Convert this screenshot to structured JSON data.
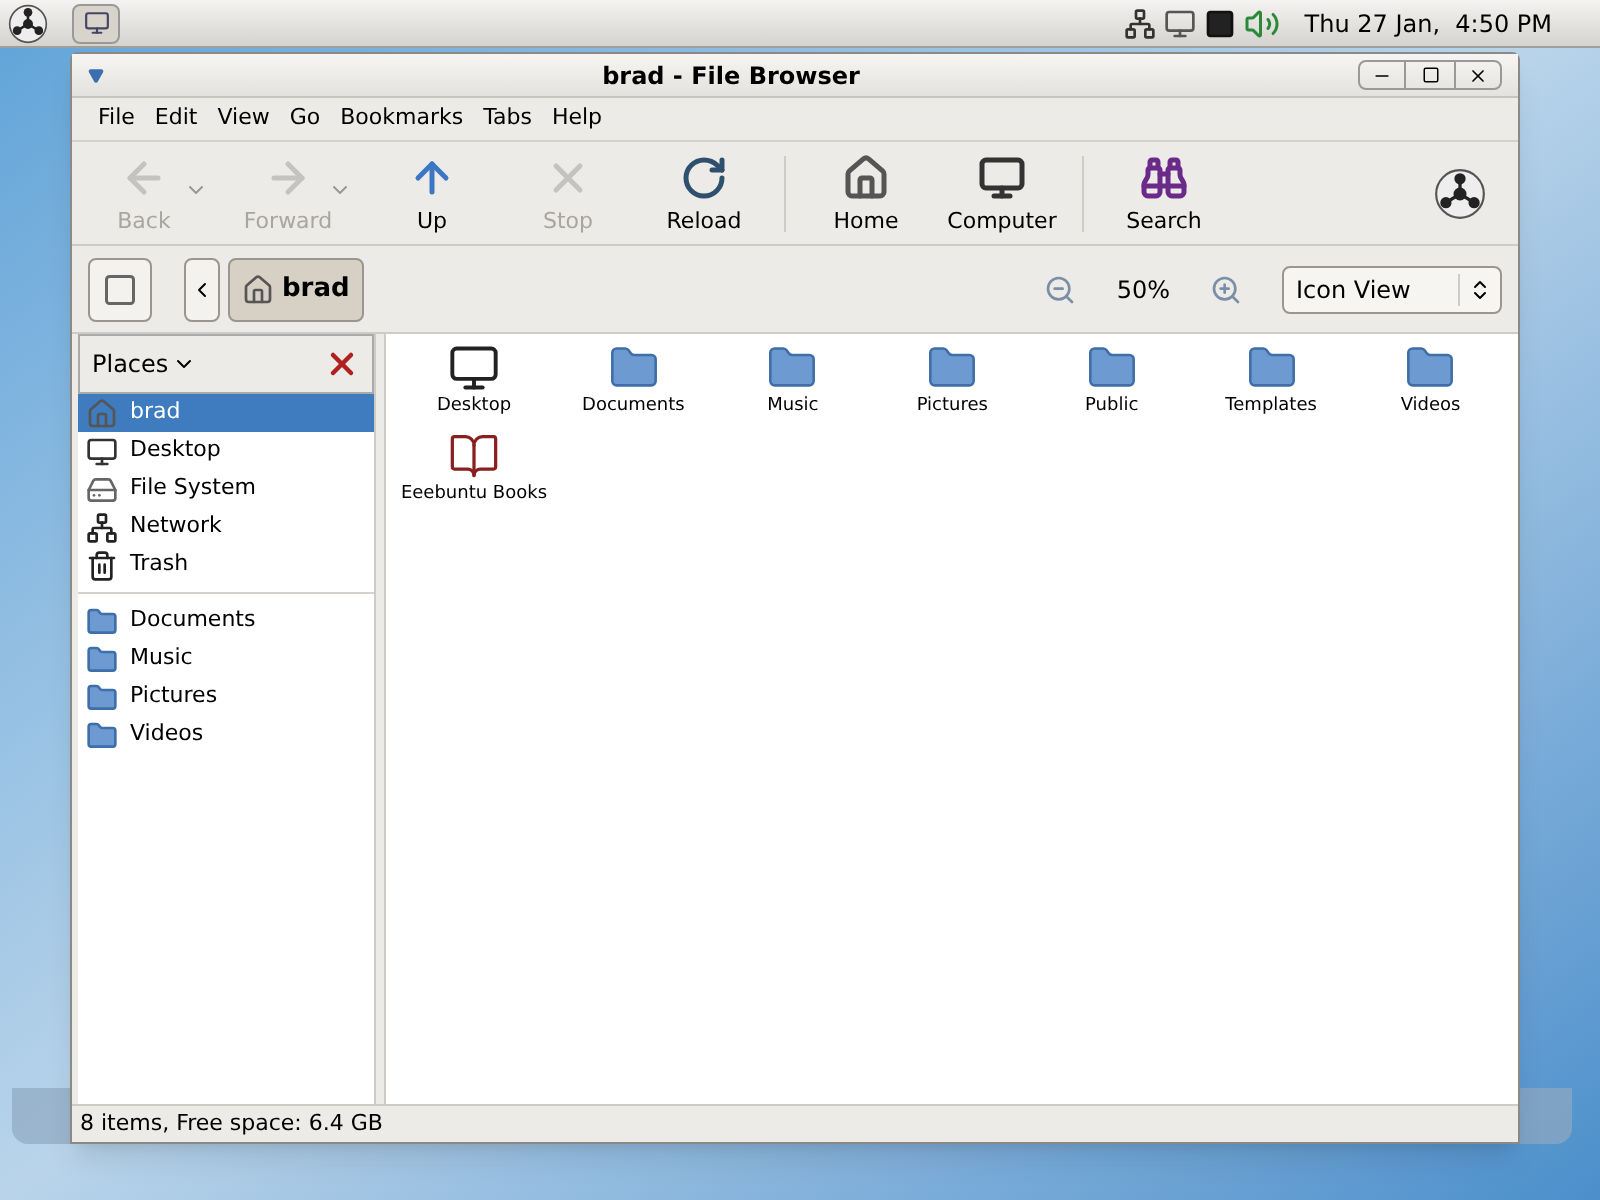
{
  "top_panel": {
    "clock": "Thu 27 Jan,  4:50 PM"
  },
  "window": {
    "title": "brad - File Browser"
  },
  "menu": [
    "File",
    "Edit",
    "View",
    "Go",
    "Bookmarks",
    "Tabs",
    "Help"
  ],
  "toolbar": [
    [
      {
        "kind": "back",
        "label": "Back",
        "disabled": true,
        "dropdown": true
      },
      {
        "kind": "forward",
        "label": "Forward",
        "disabled": true,
        "dropdown": true
      },
      {
        "kind": "up",
        "label": "Up",
        "disabled": false,
        "dropdown": false
      },
      {
        "kind": "stop",
        "label": "Stop",
        "disabled": true,
        "dropdown": false
      },
      {
        "kind": "reload",
        "label": "Reload",
        "disabled": false,
        "dropdown": false
      }
    ],
    [
      {
        "kind": "home",
        "label": "Home",
        "disabled": false,
        "dropdown": false
      },
      {
        "kind": "computer",
        "label": "Computer",
        "disabled": false,
        "dropdown": false
      }
    ],
    [
      {
        "kind": "search",
        "label": "Search",
        "disabled": false,
        "dropdown": false
      }
    ]
  ],
  "location": {
    "path": [
      {
        "label": "brad",
        "selected": true
      }
    ],
    "zoom": "50%",
    "view": "Icon View"
  },
  "sidebar": {
    "title": "Places",
    "sections": [
      [
        {
          "kind": "home",
          "label": "brad",
          "selected": true
        },
        {
          "kind": "desktop",
          "label": "Desktop",
          "selected": false
        },
        {
          "kind": "drive",
          "label": "File System",
          "selected": false
        },
        {
          "kind": "network",
          "label": "Network",
          "selected": false
        },
        {
          "kind": "trash",
          "label": "Trash",
          "selected": false
        }
      ],
      [
        {
          "kind": "folder",
          "label": "Documents",
          "selected": false
        },
        {
          "kind": "folder",
          "label": "Music",
          "selected": false
        },
        {
          "kind": "folder",
          "label": "Pictures",
          "selected": false
        },
        {
          "kind": "folder",
          "label": "Videos",
          "selected": false
        }
      ]
    ]
  },
  "files": [
    {
      "kind": "desktop",
      "name": "Desktop"
    },
    {
      "kind": "folder",
      "name": "Documents"
    },
    {
      "kind": "folder",
      "name": "Music"
    },
    {
      "kind": "folder",
      "name": "Pictures"
    },
    {
      "kind": "folder",
      "name": "Public"
    },
    {
      "kind": "folder",
      "name": "Templates"
    },
    {
      "kind": "folder",
      "name": "Videos"
    },
    {
      "kind": "book",
      "name": "Eeebuntu Books"
    }
  ],
  "status_bar": "8 items, Free space: 6.4 GB"
}
